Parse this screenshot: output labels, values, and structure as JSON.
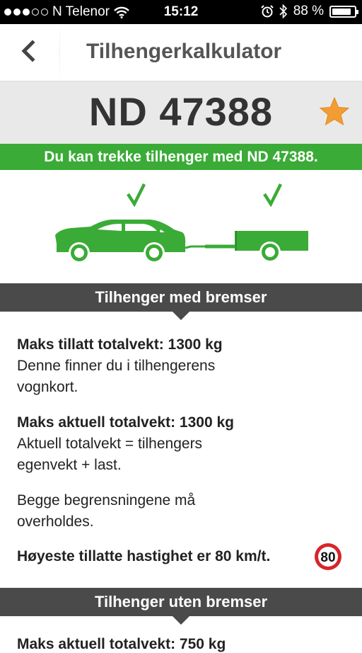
{
  "status_bar": {
    "carrier": "N Telenor",
    "time": "15:12",
    "battery_percent": "88 %",
    "battery_level": 0.88
  },
  "nav": {
    "title": "Tilhengerkalkulator"
  },
  "plate": {
    "number": "ND 47388"
  },
  "banner": {
    "text": "Du kan trekke tilhenger med ND 47388."
  },
  "section_braked": {
    "title": "Tilhenger med bremser",
    "max_allowed_label": "Maks tillatt totalvekt: 1300 kg",
    "max_allowed_desc": "Denne finner du i tilhengerens vognkort.",
    "max_actual_label": "Maks aktuell totalvekt: 1300 kg",
    "max_actual_desc": "Aktuell totalvekt = tilhengers egenvekt + last.",
    "both_limits": "Begge begrensningene må overholdes.",
    "speed_text": "Høyeste tillatte hastighet er 80 km/t.",
    "speed_sign": "80"
  },
  "section_unbraked": {
    "title": "Tilhenger uten bremser",
    "partial_label": "Maks aktuell totalvekt: 750 kg"
  },
  "colors": {
    "green": "#3aab36",
    "header_dark": "#4a4a4a",
    "star": "#f39c33",
    "sign_red": "#d7252b"
  },
  "icons": [
    "back-chevron-icon",
    "star-icon",
    "checkmark-icon",
    "car-icon",
    "trailer-icon",
    "speed-limit-sign-icon",
    "wifi-icon",
    "alarm-icon",
    "bluetooth-icon",
    "battery-icon"
  ]
}
